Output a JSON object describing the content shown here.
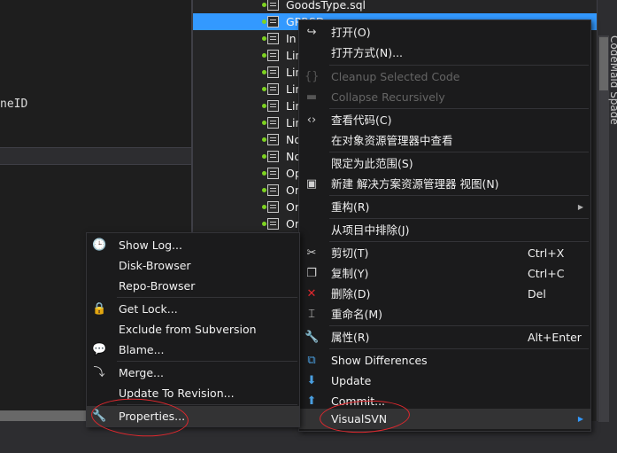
{
  "editor": {
    "code_fragment": "neID"
  },
  "tree": {
    "items": [
      {
        "text": "GoodsType.sql",
        "selected": false
      },
      {
        "text": "GPRSD...",
        "selected": true
      },
      {
        "text": "In",
        "selected": false
      },
      {
        "text": "Lin",
        "selected": false
      },
      {
        "text": "Lin",
        "selected": false
      },
      {
        "text": "Lin",
        "selected": false
      },
      {
        "text": "Lin",
        "selected": false
      },
      {
        "text": "Lin",
        "selected": false
      },
      {
        "text": "No",
        "selected": false
      },
      {
        "text": "No",
        "selected": false
      },
      {
        "text": "Op",
        "selected": false
      },
      {
        "text": "Or",
        "selected": false
      },
      {
        "text": "Or",
        "selected": false
      },
      {
        "text": "Or",
        "selected": false
      }
    ]
  },
  "side_tab": {
    "label": "CodeMaid Spade"
  },
  "context_menu": {
    "open": "打开(O)",
    "open_with": "打开方式(N)...",
    "cleanup_selected": "Cleanup Selected Code",
    "collapse_recursively": "Collapse Recursively",
    "view_code": "查看代码(C)",
    "view_in_object_browser": "在对象资源管理器中查看",
    "scope_to_this": "限定为此范围(S)",
    "new_solution_view": "新建 解决方案资源管理器 视图(N)",
    "refactor": "重构(R)",
    "exclude_from_project": "从项目中排除(J)",
    "cut": "剪切(T)",
    "cut_shortcut": "Ctrl+X",
    "copy": "复制(Y)",
    "copy_shortcut": "Ctrl+C",
    "delete": "删除(D)",
    "delete_shortcut": "Del",
    "rename": "重命名(M)",
    "properties": "属性(R)",
    "properties_shortcut": "Alt+Enter",
    "show_differences": "Show Differences",
    "update": "Update",
    "commit": "Commit...",
    "visualsvn": "VisualSVN"
  },
  "submenu": {
    "show_log": "Show Log...",
    "disk_browser": "Disk-Browser",
    "repo_browser": "Repo-Browser",
    "get_lock": "Get Lock...",
    "exclude_from_subversion": "Exclude from Subversion",
    "blame": "Blame...",
    "merge": "Merge...",
    "update_to_revision": "Update To Revision...",
    "properties": "Properties..."
  },
  "colors": {
    "selection": "#3399ff",
    "menu_bg": "#1b1b1c",
    "annotation": "#e0282e",
    "svn_dot": "#7ed321"
  }
}
